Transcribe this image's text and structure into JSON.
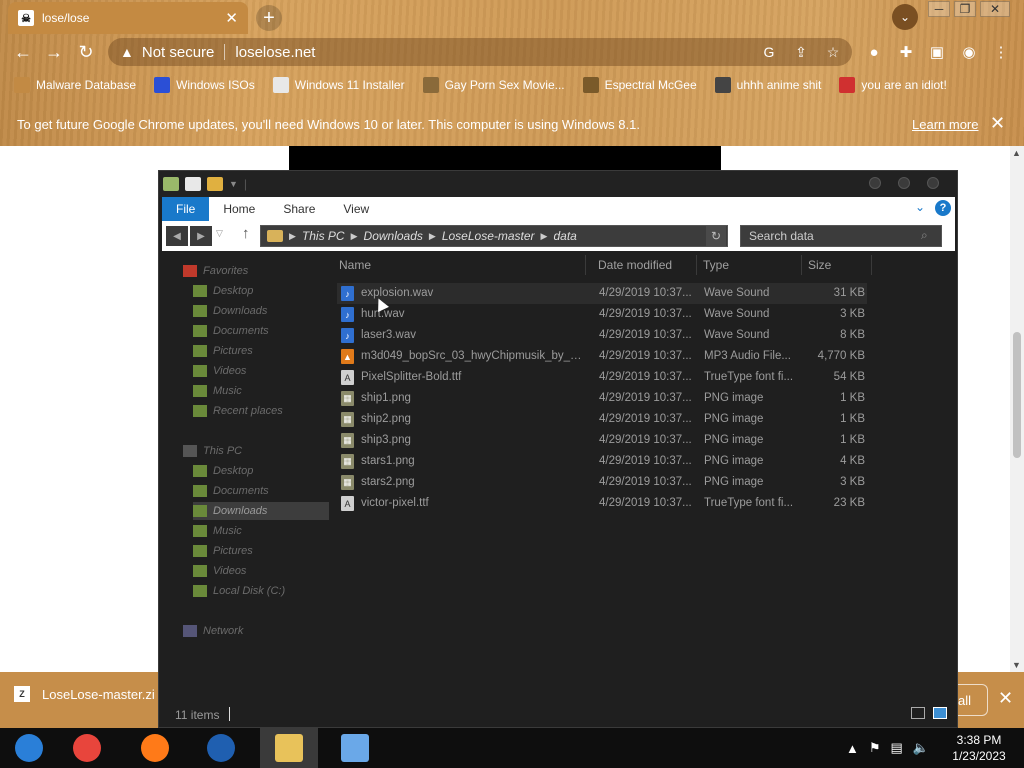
{
  "browser": {
    "tab_title": "lose/lose",
    "tab_icon_glyph": "☠",
    "address": "loselose.net",
    "security_label": "Not secure",
    "bookmarks": [
      {
        "label": "Malware Database",
        "icon": "skull-icon",
        "color": "#c28a44"
      },
      {
        "label": "Windows ISOs",
        "icon": "x-icon",
        "color": "#2b4fd6"
      },
      {
        "label": "Windows 11 Installer",
        "icon": "image-icon",
        "color": "#e8e8e8"
      },
      {
        "label": "Gay Porn Sex Movie...",
        "icon": "face-icon",
        "color": "#8a6a3a"
      },
      {
        "label": "Espectral McGee",
        "icon": "avatar-icon",
        "color": "#7a5a2a"
      },
      {
        "label": "uhhh anime shit",
        "icon": "anime-icon",
        "color": "#444444"
      },
      {
        "label": "you are an idiot!",
        "icon": "flag-icon",
        "color": "#d03030"
      }
    ],
    "infobar_text": "To get future Google Chrome updates, you'll need Windows 10 or later. This computer is using Windows 8.1.",
    "infobar_link": "Learn more"
  },
  "download": {
    "filename": "LoseLose-master.zi",
    "show_all": "all"
  },
  "explorer": {
    "ribbon_tabs": [
      "File",
      "Home",
      "Share",
      "View"
    ],
    "breadcrumb": [
      "This PC",
      "Downloads",
      "LoseLose-master",
      "data"
    ],
    "search_placeholder": "Search data",
    "columns": {
      "name": "Name",
      "date": "Date modified",
      "type": "Type",
      "size": "Size"
    },
    "nav": {
      "favorites": "Favorites",
      "fav_items": [
        "Desktop",
        "Downloads",
        "Documents",
        "Pictures",
        "Videos",
        "Music",
        "Recent places"
      ],
      "thispc": "This PC",
      "pc_items": [
        "Desktop",
        "Documents",
        "Downloads",
        "Music",
        "Pictures",
        "Videos",
        "Local Disk (C:)"
      ],
      "network": "Network"
    },
    "files": [
      {
        "name": "explosion.wav",
        "date": "4/29/2019 10:37...",
        "type": "Wave Sound",
        "size": "31 KB",
        "kind": "wav"
      },
      {
        "name": "hurt.wav",
        "date": "4/29/2019 10:37...",
        "type": "Wave Sound",
        "size": "3 KB",
        "kind": "wav"
      },
      {
        "name": "laser3.wav",
        "date": "4/29/2019 10:37...",
        "type": "Wave Sound",
        "size": "8 KB",
        "kind": "wav"
      },
      {
        "name": "m3d049_bopSrc_03_hwyChipmusik_by_x...",
        "date": "4/29/2019 10:37...",
        "type": "MP3 Audio File...",
        "size": "4,770 KB",
        "kind": "mp3"
      },
      {
        "name": "PixelSplitter-Bold.ttf",
        "date": "4/29/2019 10:37...",
        "type": "TrueType font fi...",
        "size": "54 KB",
        "kind": "ttf"
      },
      {
        "name": "ship1.png",
        "date": "4/29/2019 10:37...",
        "type": "PNG image",
        "size": "1 KB",
        "kind": "png"
      },
      {
        "name": "ship2.png",
        "date": "4/29/2019 10:37...",
        "type": "PNG image",
        "size": "1 KB",
        "kind": "png"
      },
      {
        "name": "ship3.png",
        "date": "4/29/2019 10:37...",
        "type": "PNG image",
        "size": "1 KB",
        "kind": "png"
      },
      {
        "name": "stars1.png",
        "date": "4/29/2019 10:37...",
        "type": "PNG image",
        "size": "4 KB",
        "kind": "png"
      },
      {
        "name": "stars2.png",
        "date": "4/29/2019 10:37...",
        "type": "PNG image",
        "size": "3 KB",
        "kind": "png"
      },
      {
        "name": "victor-pixel.ttf",
        "date": "4/29/2019 10:37...",
        "type": "TrueType font fi...",
        "size": "23 KB",
        "kind": "ttf"
      }
    ],
    "status": "11 items"
  },
  "taskbar": {
    "apps": [
      {
        "name": "ie-icon",
        "color": "#2a7fd8"
      },
      {
        "name": "chrome-icon",
        "color": "#e8453c"
      },
      {
        "name": "firefox-icon",
        "color": "#ff7a18"
      },
      {
        "name": "obama-icon",
        "color": "#1f5fb0"
      },
      {
        "name": "file-explorer-icon",
        "color": "#e8c25a"
      },
      {
        "name": "msn-icon",
        "color": "#6aa8e8"
      }
    ],
    "time": "3:38 PM",
    "date": "1/23/2023"
  },
  "colors": {
    "accent": "#1979ca",
    "chrome_bg": "#cf9a56",
    "explorer_bg": "#1f1f1f"
  }
}
